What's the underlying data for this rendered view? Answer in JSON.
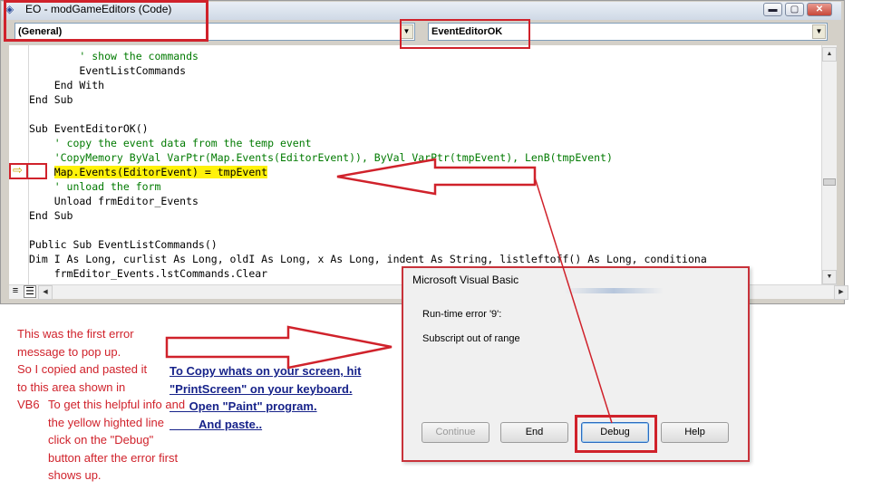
{
  "window": {
    "title": "EO - modGameEditors (Code)",
    "icon": "vb-project-icon",
    "buttons": {
      "minimize": "▬",
      "maximize": "▢",
      "close": "✕"
    }
  },
  "combos": {
    "object": "(General)",
    "procedure": "EventEditorOK"
  },
  "code_lines": [
    {
      "text": "        ' show the commands",
      "kind": "comment"
    },
    {
      "text": "        EventListCommands",
      "kind": "code"
    },
    {
      "text": "    End With",
      "kind": "code"
    },
    {
      "text": "End Sub",
      "kind": "code"
    },
    {
      "text": "",
      "kind": "code"
    },
    {
      "text": "Sub EventEditorOK()",
      "kind": "code"
    },
    {
      "text": "    ' copy the event data from the temp event",
      "kind": "comment"
    },
    {
      "text": "    'CopyMemory ByVal VarPtr(Map.Events(EditorEvent)), ByVal VarPtr(tmpEvent), LenB(tmpEvent)",
      "kind": "comment"
    },
    {
      "text": "Map.Events(EditorEvent) = tmpEvent",
      "kind": "highlight",
      "indent": "    "
    },
    {
      "text": "    ' unload the form",
      "kind": "comment"
    },
    {
      "text": "    Unload frmEditor_Events",
      "kind": "code"
    },
    {
      "text": "End Sub",
      "kind": "code"
    },
    {
      "text": "",
      "kind": "code"
    },
    {
      "text": "Public Sub EventListCommands()",
      "kind": "code"
    },
    {
      "text": "Dim I As Long, curlist As Long, oldI As Long, x As Long, indent As String, listleftoff() As Long, conditiona",
      "kind": "code"
    },
    {
      "text": "    frmEditor_Events.lstCommands.Clear",
      "kind": "code"
    }
  ],
  "exec_pointer": "⇨",
  "dialog": {
    "title": "Microsoft Visual Basic",
    "error_code": "Run-time error '9':",
    "message": "Subscript out of range",
    "buttons": {
      "continue": "Continue",
      "end": "End",
      "debug": "Debug",
      "help": "Help"
    }
  },
  "annotations": {
    "note1_lines": [
      "This was the first error",
      "message to pop up.",
      "So I copied and pasted it",
      "to this area shown in",
      "VB6"
    ],
    "note2_lines": [
      "To get this helpful info and",
      "the yellow highted line",
      "click on the \"Debug\"",
      "button after the error first",
      "shows up."
    ],
    "blue_lines": [
      "To Copy whats on your screen, hit",
      "\"PrintScreen\" on your keyboard.",
      "      Open \"Paint\" program.",
      "         And paste.."
    ]
  },
  "colors": {
    "annotation_red": "#d0222b",
    "annotation_blue": "#17238a",
    "highlight_yellow": "#fff20a",
    "comment_green": "#007a00"
  }
}
